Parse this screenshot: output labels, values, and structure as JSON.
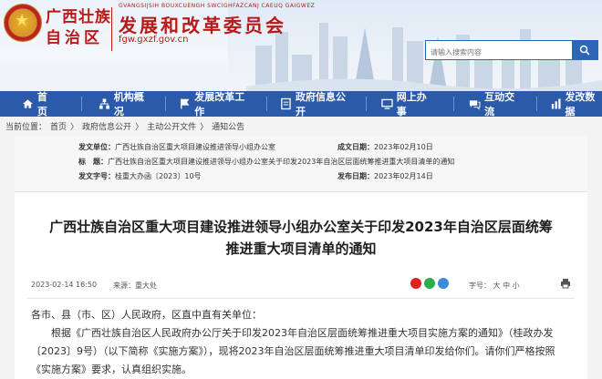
{
  "header": {
    "region_line1": "广西壮族",
    "region_line2": "自治区",
    "pinyin": "GVANGSIJSIH BOUXCUENGH SWCIGHFAZCANJ CAEUQ GAIGWEZ",
    "org_name": "发展和改革委员会",
    "domain": "fgw.gxzf.gov.cn",
    "search_placeholder": "请输入搜索内容"
  },
  "nav": {
    "items": [
      {
        "label": "首页",
        "icon": "home-icon"
      },
      {
        "label": "机构概况",
        "icon": "org-chart-icon"
      },
      {
        "label": "发展改革工作",
        "icon": "flag-icon"
      },
      {
        "label": "政府信息公开",
        "icon": "document-icon"
      },
      {
        "label": "网上办事",
        "icon": "monitor-icon"
      },
      {
        "label": "互动交流",
        "icon": "chat-icon"
      },
      {
        "label": "发改数据",
        "icon": "chart-icon"
      }
    ]
  },
  "breadcrumb": {
    "prefix": "当前位置：",
    "items": [
      "首页",
      "政府信息公开",
      "主动公开文件",
      "通知公告"
    ],
    "separator": "〉"
  },
  "meta": {
    "issuer_label": "发文单位：",
    "issuer": "广西壮族自治区重大项目建设推进领导小组办公室",
    "created_label": "成文日期：",
    "created": "2023年02月10日",
    "title_label": "标　题：",
    "title": "广西壮族自治区重大项目建设推进领导小组办公室关于印发2023年自治区层面统筹推进重大项目清单的通知",
    "docno_label": "发文字号：",
    "docno": "桂重大办函〔2023〕10号",
    "published_label": "发布日期：",
    "published": "2023年02月14日"
  },
  "article": {
    "title_line1": "广西壮族自治区重大项目建设推进领导小组办公室关于印发2023年自治区层面统筹",
    "title_line2": "推进重大项目清单的通知",
    "datetime": "2023-02-14 16:50",
    "source_label": "来源：",
    "source": "重大处",
    "font_label": "字号：",
    "font_large": "大",
    "font_medium": "中",
    "font_small": "小",
    "para1": "各市、县（市、区）人民政府，区直中直有关单位：",
    "para2": "　　根据《广西壮族自治区人民政府办公厅关于印发2023年自治区层面统筹推进重大项目实施方案的通知》（桂政办发〔2023〕9号）（以下简称《实施方案》），现将2023年自治区层面统筹推进重大项目清单印发给你们。请你们严格按照《实施方案》要求，认真组织实施。"
  },
  "colors": {
    "brand_red": "#b81a17",
    "nav_blue": "#2a5aa9"
  }
}
